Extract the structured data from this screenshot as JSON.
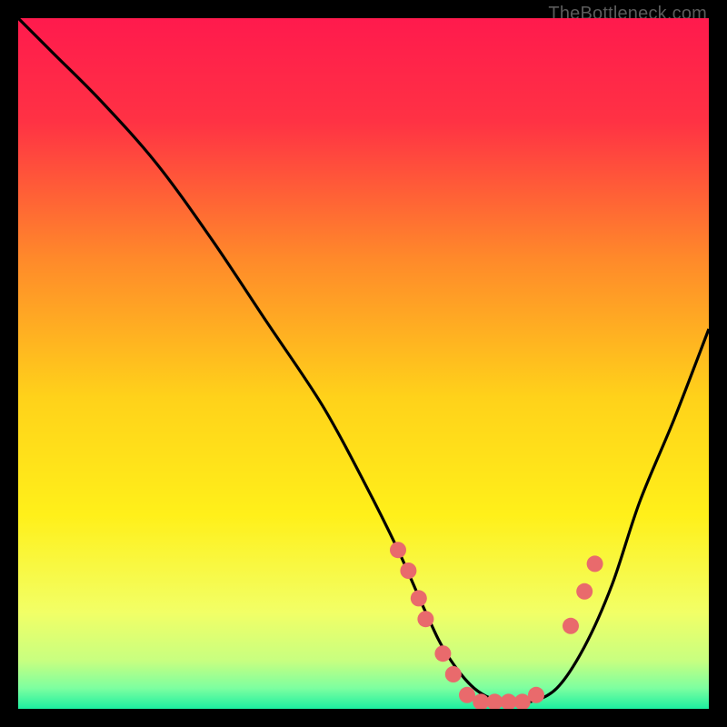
{
  "attribution": "TheBottleneck.com",
  "chart_data": {
    "type": "line",
    "title": "",
    "xlabel": "",
    "ylabel": "",
    "xlim": [
      0,
      100
    ],
    "ylim": [
      0,
      100
    ],
    "gradient_stops": [
      {
        "offset": 0.0,
        "color": "#ff1a4d"
      },
      {
        "offset": 0.15,
        "color": "#ff3244"
      },
      {
        "offset": 0.35,
        "color": "#ff8a2a"
      },
      {
        "offset": 0.55,
        "color": "#ffd21a"
      },
      {
        "offset": 0.72,
        "color": "#fff01a"
      },
      {
        "offset": 0.86,
        "color": "#f2ff66"
      },
      {
        "offset": 0.93,
        "color": "#c8ff80"
      },
      {
        "offset": 0.97,
        "color": "#7dffa0"
      },
      {
        "offset": 1.0,
        "color": "#1cefa0"
      }
    ],
    "series": [
      {
        "name": "bottleneck-curve",
        "x": [
          0,
          5,
          12,
          20,
          28,
          36,
          44,
          50,
          55,
          59,
          62,
          66,
          70,
          74,
          78,
          82,
          86,
          90,
          95,
          100
        ],
        "y": [
          100,
          95,
          88,
          79,
          68,
          56,
          44,
          33,
          23,
          14,
          8,
          3,
          1,
          1,
          3,
          9,
          18,
          30,
          42,
          55
        ]
      }
    ],
    "markers": {
      "name": "sample-points",
      "x": [
        55,
        56.5,
        58,
        59,
        61.5,
        63,
        65,
        67,
        69,
        71,
        73,
        75,
        80,
        82,
        83.5
      ],
      "y": [
        23,
        20,
        16,
        13,
        8,
        5,
        2,
        1,
        1,
        1,
        1,
        2,
        12,
        17,
        21
      ],
      "color": "#e96a6c",
      "radius": 9
    }
  }
}
